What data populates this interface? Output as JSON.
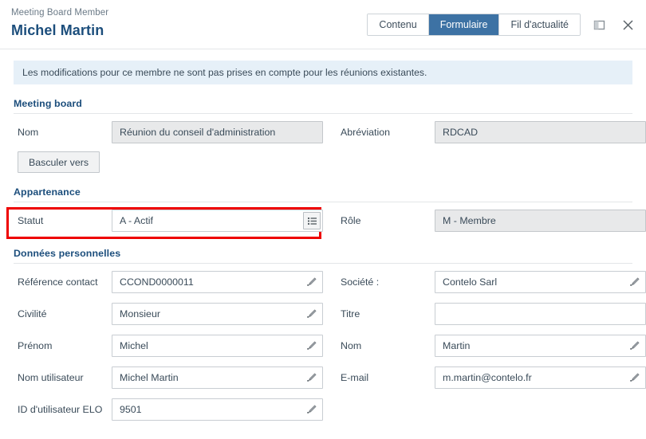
{
  "header": {
    "breadcrumb": "Meeting Board Member",
    "title": "Michel Martin",
    "tabs": [
      {
        "label": "Contenu",
        "active": false
      },
      {
        "label": "Formulaire",
        "active": true
      },
      {
        "label": "Fil d'actualité",
        "active": false
      }
    ],
    "window_buttons": [
      {
        "name": "restore-window-icon",
        "label": "restore-window-icon"
      },
      {
        "name": "close-icon",
        "label": "close-icon"
      }
    ]
  },
  "banner": {
    "text": "Les modifications pour ce membre ne sont pas prises en compte pour les réunions existantes.",
    "background": "#e6f0f8"
  },
  "sections": {
    "meeting_board": {
      "title": "Meeting board",
      "fields": {
        "nom_label": "Nom",
        "nom_value": "Réunion du conseil d'administration",
        "abreviation_label": "Abréviation",
        "abreviation_value": "RDCAD"
      },
      "switch_button_label": "Basculer vers"
    },
    "appartenance": {
      "title": "Appartenance",
      "fields": {
        "statut_label": "Statut",
        "statut_value": "A - Actif",
        "statut_icon": "list-icon",
        "role_label": "Rôle",
        "role_value": "M - Membre"
      },
      "highlight_color": "#ee0000"
    },
    "donnees_personnelles": {
      "title": "Données personnelles",
      "rows": [
        {
          "left": {
            "label": "Référence contact",
            "required": false,
            "value": "CCOND0000011",
            "icon": "pencil-icon"
          },
          "right": {
            "label": "Société :",
            "required": false,
            "value": "Contelo Sarl",
            "icon": "pencil-icon"
          }
        },
        {
          "left": {
            "label": "Civilité",
            "required": false,
            "value": "Monsieur",
            "icon": "pencil-icon"
          },
          "right": {
            "label": "Titre",
            "required": false,
            "value": "",
            "icon": ""
          }
        },
        {
          "left": {
            "label": "Prénom",
            "required": true,
            "value": "Michel",
            "icon": "pencil-icon"
          },
          "right": {
            "label": "Nom",
            "required": true,
            "value": "Martin",
            "icon": "pencil-icon"
          }
        },
        {
          "left": {
            "label": "Nom utilisateur",
            "required": false,
            "value": "Michel Martin",
            "icon": "pencil-icon"
          },
          "right": {
            "label": "E-mail",
            "required": true,
            "value": "m.martin@contelo.fr",
            "icon": "pencil-icon"
          }
        },
        {
          "left": {
            "label": "ID d'utilisateur ELO",
            "required": false,
            "value": "9501",
            "icon": "pencil-icon"
          },
          "right": {
            "label": "",
            "required": false,
            "value": "",
            "icon": ""
          }
        }
      ]
    }
  },
  "colors": {
    "accent": "#1c4e7c",
    "tab_active": "#3d72a4",
    "highlight": "#ee0000",
    "readonly_field": "#e8e9ea"
  }
}
